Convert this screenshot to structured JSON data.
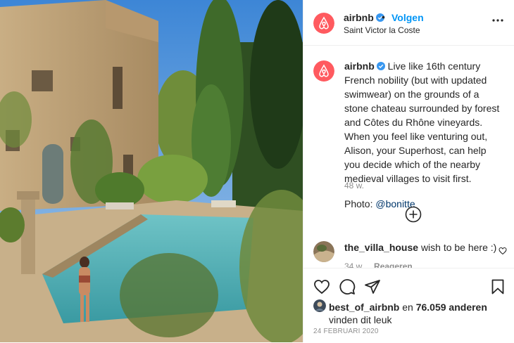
{
  "photo": {
    "icon": "post-photo",
    "subject": "stone chateau with pool and cypress trees"
  },
  "header": {
    "username": "airbnb",
    "separator": "•",
    "follow_label": "Volgen",
    "location": "Saint Victor la Coste",
    "more_icon": "more-options-icon"
  },
  "caption": {
    "username": "airbnb",
    "text": "Live like 16th century French nobility (but with updated swimwear) on the grounds of a stone chateau surrounded by forest and Côtes du Rhône vineyards. When you feel like venturing out, Alison, your Superhost, can help you decide which of the nearby medieval villages to visit first.",
    "photo_prefix": "Photo: ",
    "photo_mention": "@bonitte",
    "age": "48 w."
  },
  "comment": {
    "username": "the_villa_house",
    "text": "wish to be here :)",
    "age": "34 w.",
    "reply_label": "Reageren"
  },
  "likes": {
    "username": "best_of_airbnb",
    "mid": "en",
    "count": "76.059 anderen",
    "line2": "vinden dit leuk"
  },
  "date": "24 FEBRUARI 2020",
  "colors": {
    "brand": "#ff5a5f",
    "link": "#0095f6",
    "verified": "#3897f0",
    "muted": "#8e8e8e"
  }
}
